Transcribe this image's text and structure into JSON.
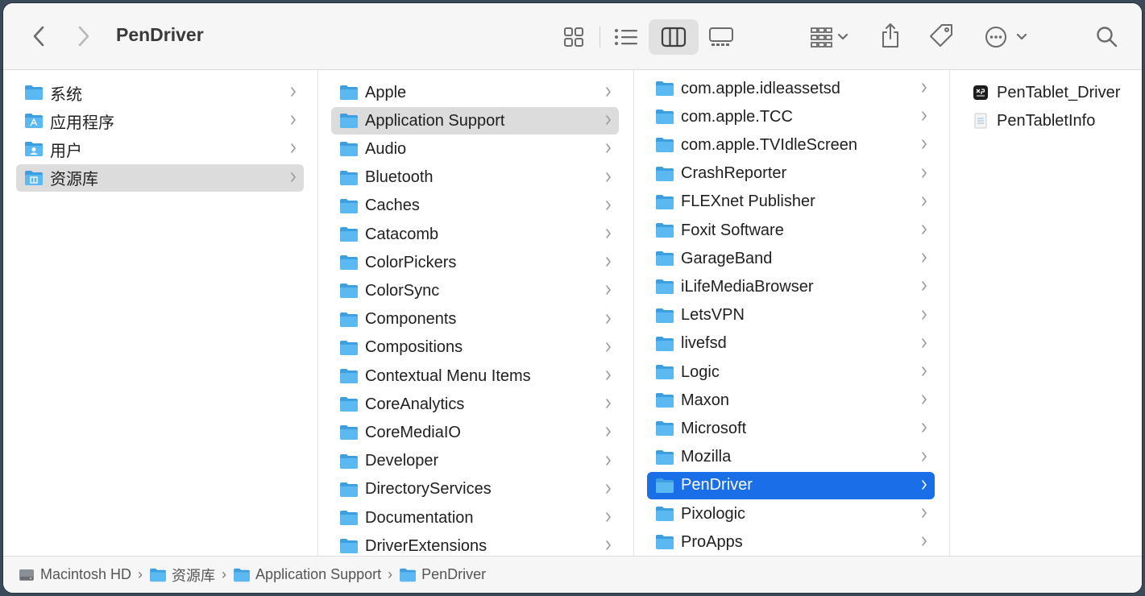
{
  "window": {
    "title": "PenDriver"
  },
  "toolbar": {
    "back_icon": "chevron-left-icon",
    "forward_icon": "chevron-right-icon",
    "view_icons": [
      "icon-view-icon",
      "list-view-icon",
      "column-view-icon",
      "gallery-view-icon"
    ],
    "active_view": "column",
    "group_icon": "group-icon",
    "share_icon": "share-icon",
    "tag_icon": "tag-icon",
    "more_icon": "ellipsis-circle-icon",
    "search_icon": "search-icon"
  },
  "columns": {
    "sidebar": [
      {
        "label": "系统",
        "icon": "folder-icon"
      },
      {
        "label": "应用程序",
        "icon": "applications-folder-icon"
      },
      {
        "label": "用户",
        "icon": "users-folder-icon"
      },
      {
        "label": "资源库",
        "icon": "library-folder-icon",
        "selected": true
      }
    ],
    "library": [
      {
        "label": "Apple"
      },
      {
        "label": "Application Support",
        "selected": true
      },
      {
        "label": "Audio"
      },
      {
        "label": "Bluetooth"
      },
      {
        "label": "Caches"
      },
      {
        "label": "Catacomb"
      },
      {
        "label": "ColorPickers"
      },
      {
        "label": "ColorSync"
      },
      {
        "label": "Components"
      },
      {
        "label": "Compositions"
      },
      {
        "label": "Contextual Menu Items"
      },
      {
        "label": "CoreAnalytics"
      },
      {
        "label": "CoreMediaIO"
      },
      {
        "label": "Developer"
      },
      {
        "label": "DirectoryServices"
      },
      {
        "label": "Documentation"
      },
      {
        "label": "DriverExtensions"
      }
    ],
    "app_support": [
      {
        "label": "com.apple.idleassetsd"
      },
      {
        "label": "com.apple.TCC"
      },
      {
        "label": "com.apple.TVIdleScreen"
      },
      {
        "label": "CrashReporter"
      },
      {
        "label": "FLEXnet Publisher"
      },
      {
        "label": "Foxit Software"
      },
      {
        "label": "GarageBand"
      },
      {
        "label": "iLifeMediaBrowser"
      },
      {
        "label": "LetsVPN"
      },
      {
        "label": "livefsd"
      },
      {
        "label": "Logic"
      },
      {
        "label": "Maxon"
      },
      {
        "label": "Microsoft"
      },
      {
        "label": "Mozilla"
      },
      {
        "label": "PenDriver",
        "selected": true
      },
      {
        "label": "Pixologic"
      },
      {
        "label": "ProApps"
      }
    ],
    "pendriver": [
      {
        "label": "PenTablet_Driver",
        "icon": "xp-pen-app-icon"
      },
      {
        "label": "PenTabletInfo",
        "icon": "plist-file-icon"
      }
    ]
  },
  "pathbar": {
    "crumbs": [
      {
        "label": "Macintosh HD",
        "icon": "hard-drive-icon"
      },
      {
        "label": "资源库",
        "icon": "folder-icon"
      },
      {
        "label": "Application Support",
        "icon": "folder-icon"
      },
      {
        "label": "PenDriver",
        "icon": "folder-icon"
      }
    ]
  },
  "colors": {
    "selection_blue": "#1a6ee8",
    "selection_gray": "#dcdcdc",
    "folder_blue": "#5bb8f0"
  }
}
